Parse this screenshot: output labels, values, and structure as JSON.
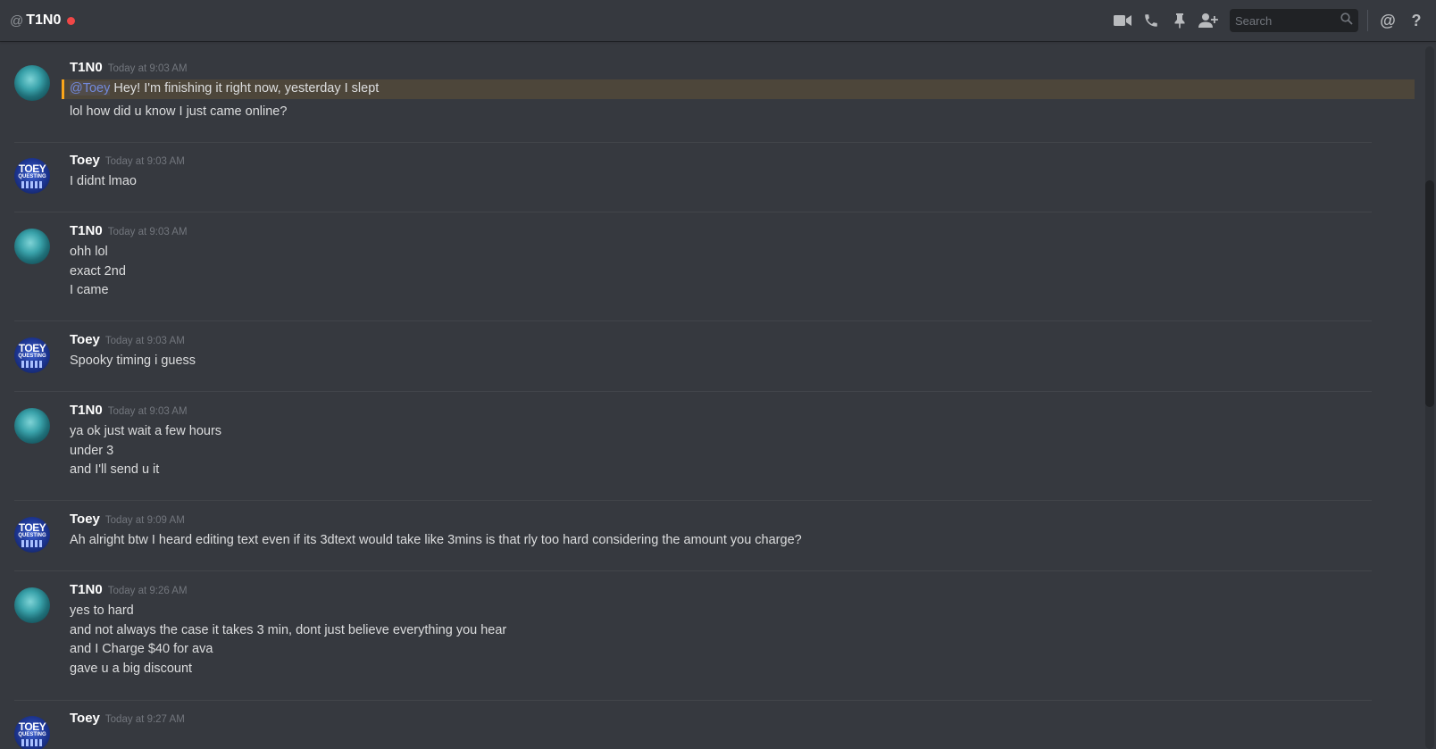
{
  "header": {
    "at_symbol": "@",
    "channel_name": "T1N0",
    "status_color": "#f04747",
    "search_placeholder": "Search",
    "icons": [
      "video-camera-icon",
      "phone-icon",
      "pin-icon",
      "add-member-icon",
      "search-icon",
      "mention-icon",
      "help-icon"
    ],
    "mention_glyph": "@",
    "help_glyph": "?"
  },
  "colors": {
    "background": "#36393f",
    "header_bg": "#36393f",
    "search_bg": "#202225",
    "username": "#ffffff",
    "timestamp": "#72767d",
    "text": "#dcddde",
    "mention_accent": "#faa61a",
    "mention_text": "#7289da"
  },
  "messages": [
    {
      "author": "T1N0",
      "time": "Today at 9:03 AM",
      "mention": "@Toey",
      "mention_rest": " Hey! I'm finishing it right now, yesterday I slept",
      "lines": [
        "lol how did u know I just came online?"
      ]
    },
    {
      "author": "Toey",
      "time": "Today at 9:03 AM",
      "lines": [
        "I didnt lmao"
      ]
    },
    {
      "author": "T1N0",
      "time": "Today at 9:03 AM",
      "lines": [
        "ohh lol",
        "exact 2nd",
        "I came"
      ]
    },
    {
      "author": "Toey",
      "time": "Today at 9:03 AM",
      "lines": [
        "Spooky timing i guess"
      ]
    },
    {
      "author": "T1N0",
      "time": "Today at 9:03 AM",
      "lines": [
        "ya ok just wait a few hours",
        "under 3",
        "and I'll send u it"
      ]
    },
    {
      "author": "Toey",
      "time": "Today at 9:09 AM",
      "lines": [
        "Ah alright btw I heard editing text even if its 3dtext would take like 3mins is that rly too hard considering the amount you charge?"
      ]
    },
    {
      "author": "T1N0",
      "time": "Today at 9:26 AM",
      "lines": [
        "yes to hard",
        "and not always the case it takes 3 min, dont just believe everything you hear",
        "and I Charge $40 for ava",
        "gave u a big discount"
      ]
    },
    {
      "author": "Toey",
      "time": "Today at 9:27 AM",
      "lines": []
    }
  ],
  "avatars": {
    "toey": {
      "line1": "TOEY",
      "line2": "QUESTING"
    }
  }
}
